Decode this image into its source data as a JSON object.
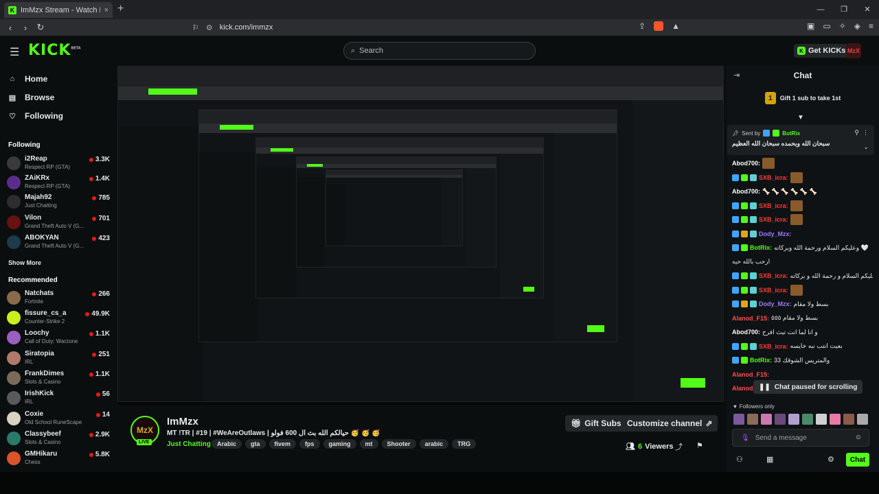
{
  "browser": {
    "tab_title": "ImMzx Stream - Watch Live o",
    "tab_close": "×",
    "new_tab": "+",
    "url": "kick.com/immzx",
    "win_min": "—",
    "win_max": "❐",
    "win_close": "✕"
  },
  "header": {
    "logo": "KICK",
    "logo_beta": "BETA",
    "search_placeholder": "Search",
    "get_kicks": "Get KICKs",
    "avatar_text": "MzX"
  },
  "sidebar": {
    "nav": [
      {
        "label": "Home",
        "icon": "home-icon"
      },
      {
        "label": "Browse",
        "icon": "browse-icon"
      },
      {
        "label": "Following",
        "icon": "heart-icon"
      }
    ],
    "following_title": "Following",
    "following": [
      {
        "name": "i2Reap",
        "game": "Respect RP (GTA)",
        "viewers": "3.3K"
      },
      {
        "name": "ZAiKRx",
        "game": "Respect RP (GTA)",
        "viewers": "1.4K"
      },
      {
        "name": "Majah92",
        "game": "Just Chatting",
        "viewers": "785"
      },
      {
        "name": "Vilon",
        "game": "Grand Theft Auto V (G...",
        "viewers": "701"
      },
      {
        "name": "ABOKYAN",
        "game": "Grand Theft Auto V (G...",
        "viewers": "423"
      }
    ],
    "show_more": "Show More",
    "recommended_title": "Recommended",
    "recommended": [
      {
        "name": "Natchats",
        "game": "Fortnite",
        "viewers": "266"
      },
      {
        "name": "fissure_cs_a",
        "game": "Counter-Strike 2",
        "viewers": "49.9K"
      },
      {
        "name": "Loochy",
        "game": "Call of Duty: Warzone",
        "viewers": "1.1K"
      },
      {
        "name": "Siratopia",
        "game": "IRL",
        "viewers": "251"
      },
      {
        "name": "FrankDimes",
        "game": "Slots & Casino",
        "viewers": "1.1K"
      },
      {
        "name": "IrishKick",
        "game": "IRL",
        "viewers": "56"
      },
      {
        "name": "Coxie",
        "game": "Old School RuneScape",
        "viewers": "14"
      },
      {
        "name": "Classybeef",
        "game": "Slots & Casino",
        "viewers": "2.9K"
      },
      {
        "name": "GMHikaru",
        "game": "Chess",
        "viewers": "5.8K"
      }
    ]
  },
  "stream": {
    "avatar_text": "MzX",
    "live": "LIVE",
    "name": "ImMzx",
    "title": "MT !TR | #19 | #WeAreOutlaws | حيالكم الله بث ال 600 فولو 🥳 🥳 🥳",
    "category": "Just Chatting",
    "tags": [
      "Arabic",
      "gta",
      "fivem",
      "fps",
      "gaming",
      "mt",
      "Shooter",
      "arabic",
      "TRG"
    ],
    "gift_subs": "Gift Subs",
    "customize": "Customize channel",
    "viewers_count": "6",
    "viewers_label": "Viewers"
  },
  "chat": {
    "title": "Chat",
    "gift_prompt": "Gift 1 sub to take 1st",
    "gift_coin": "1",
    "pinned_sent_by": "Sent by",
    "pinned_user": "BotRix",
    "pinned_msg": "سبحان الله وبحمده سبحان الله العظيم",
    "messages": [
      {
        "user": "Abod700:",
        "color": "white",
        "text": "",
        "emote": true,
        "badges": []
      },
      {
        "user": "SXB_icra:",
        "color": "red",
        "text": "",
        "emote": true,
        "badges": [
          "blue",
          "green",
          "teal"
        ]
      },
      {
        "user": "Abod700:",
        "color": "white",
        "text": "🦴 🦴 🦴 🦴 🦴 🦴",
        "emote": false,
        "badges": []
      },
      {
        "user": "SXB_icra:",
        "color": "red",
        "text": "",
        "emote": true,
        "badges": [
          "blue",
          "green",
          "teal"
        ]
      },
      {
        "user": "SXB_icra:",
        "color": "red",
        "text": "",
        "emote": true,
        "badges": [
          "blue",
          "green",
          "teal"
        ]
      },
      {
        "user": "Dody_Mzx:",
        "color": "purple",
        "text": "",
        "emote": false,
        "badges": [
          "blue",
          "gold",
          "teal"
        ]
      },
      {
        "user": "BotRix:",
        "color": "green",
        "text": "وعليكم السلام ورحمة الله وبركاته 🤍",
        "emote": false,
        "badges": [
          "blue",
          "green"
        ]
      },
      {
        "user": "",
        "color": "white",
        "text": "ارحب بالله حيه",
        "emote": false,
        "badges": []
      },
      {
        "user": "SXB_icra:",
        "color": "red",
        "text": "و عليكم السلام و رحمة الله و بركاته",
        "emote": false,
        "badges": [
          "blue",
          "green",
          "teal"
        ]
      },
      {
        "user": "SXB_icra:",
        "color": "red",
        "text": "",
        "emote": true,
        "badges": [
          "blue",
          "green",
          "teal"
        ]
      },
      {
        "user": "Dody_Mzx:",
        "color": "purple",
        "text": "بسط ولا مقام",
        "emote": false,
        "badges": [
          "blue",
          "gold",
          "teal"
        ]
      },
      {
        "user": "Alanod_F15:",
        "color": "red2",
        "text": "بسط ولا مقام ٥٥٥",
        "emote": false,
        "badges": []
      },
      {
        "user": "Abod700:",
        "color": "white",
        "text": "و انا لما انت تبث افرح",
        "emote": false,
        "badges": []
      },
      {
        "user": "SXB_icra:",
        "color": "red",
        "text": "بعيت انتب نبه خايسه",
        "emote": false,
        "badges": [
          "blue",
          "green",
          "teal"
        ]
      },
      {
        "user": "BotRix:",
        "color": "green",
        "text": "والمتريس الشوقك 33",
        "emote": false,
        "badges": [
          "blue",
          "green"
        ]
      },
      {
        "user": "Alanod_F15:",
        "color": "red2",
        "text": "",
        "emote": false,
        "badges": []
      },
      {
        "user": "Alanod_F15:",
        "color": "red2",
        "text": "",
        "emote": false,
        "badges": []
      }
    ],
    "paused": "Chat paused for scrolling",
    "followers_only": "Followers only",
    "send_placeholder": "Send a message",
    "chat_button": "Chat"
  }
}
